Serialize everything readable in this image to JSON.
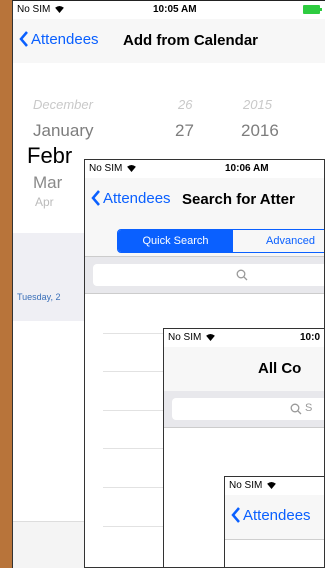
{
  "screen1": {
    "status": {
      "carrier": "No SIM",
      "time": "10:05 AM"
    },
    "nav": {
      "back_label": "Attendees",
      "title": "Add from Calendar"
    },
    "picker": {
      "rows": [
        {
          "month": "December",
          "day": "26",
          "year": "2015"
        },
        {
          "month": "January",
          "day": "27",
          "year": "2016"
        },
        {
          "month": "Febr",
          "day": "",
          "year": ""
        },
        {
          "month": "Mar",
          "day": "",
          "year": ""
        },
        {
          "month": "Apr",
          "day": "",
          "year": ""
        }
      ]
    },
    "date_label": "Tuesday, 2"
  },
  "screen2": {
    "status": {
      "carrier": "No SIM",
      "time": "10:06 AM"
    },
    "nav": {
      "back_label": "Attendees",
      "title": "Search for Atter"
    },
    "segments": {
      "quick": "Quick Search",
      "advanced": "Advanced"
    }
  },
  "screen3": {
    "status": {
      "carrier": "No SIM",
      "time": "10:0"
    },
    "nav": {
      "title": "All Co"
    },
    "search_placeholder": "S"
  },
  "screen4": {
    "status": {
      "carrier": "No SIM"
    },
    "nav": {
      "back_label": "Attendees"
    }
  },
  "colors": {
    "accent": "#0a60ff",
    "frame": "#b8743a"
  }
}
